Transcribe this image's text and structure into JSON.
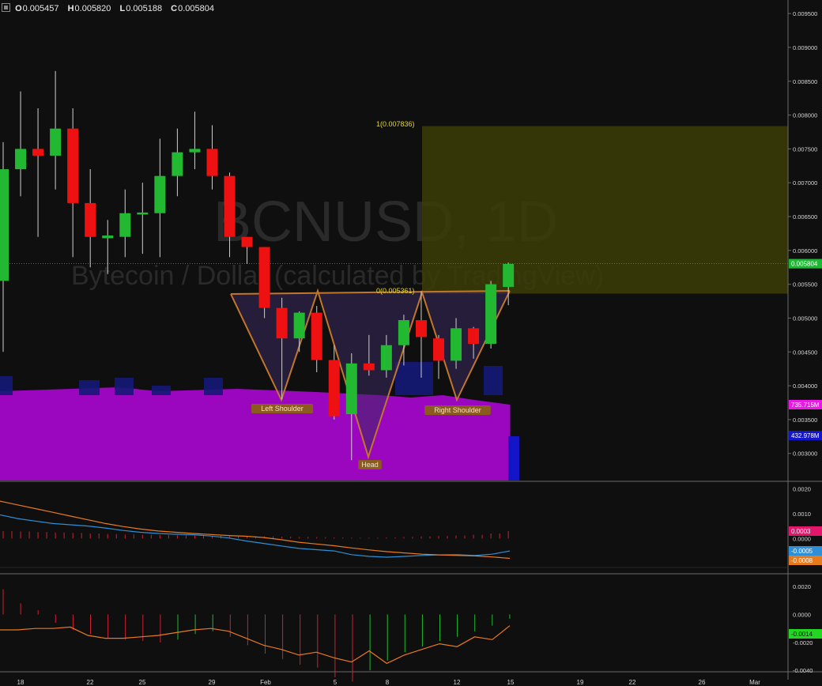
{
  "header": {
    "open_label": "O",
    "open": "0.005457",
    "high_label": "H",
    "high": "0.005820",
    "low_label": "L",
    "low": "0.005188",
    "close_label": "C",
    "close": "0.005804"
  },
  "watermark": {
    "symbol": "BCNUSD, 1D",
    "description": "Bytecoin / Dollar (calculated by TradingView)"
  },
  "colors": {
    "background": "#0f0f0f",
    "up": "#22b832",
    "down": "#ee1111",
    "pattern_line": "#c2762c",
    "pattern_fill": "#3a2a60",
    "target_box": "#3c3d06",
    "volume_fill": "#9b06bf",
    "volume_bar": "#141a78",
    "macd_line": "#2e8fd6",
    "signal_line": "#e87a1e",
    "last_price_tag": "#1db734",
    "vol_ma_tag": "#e71be3",
    "vol_tag": "#1515c8",
    "grid": "#6b6b6b"
  },
  "chart_data": [
    {
      "type": "candlestick",
      "title": "BCNUSD, 1D",
      "x_tick_labels": [
        "18",
        "22",
        "25",
        "29",
        "Feb",
        "5",
        "8",
        "12",
        "15",
        "19",
        "22",
        "26",
        "Mar"
      ],
      "y_ticks": [
        "0.009500",
        "0.009000",
        "0.008500",
        "0.008000",
        "0.007500",
        "0.007000",
        "0.006500",
        "0.006000",
        "0.005500",
        "0.005000",
        "0.004500",
        "0.004000",
        "0.003500",
        "0.003000"
      ],
      "ylim": [
        0.0026,
        0.0097
      ],
      "last_price": "0.005804",
      "candles": [
        {
          "o": 0.00555,
          "h": 0.0076,
          "l": 0.0045,
          "c": 0.0072
        },
        {
          "o": 0.0072,
          "h": 0.00835,
          "l": 0.0068,
          "c": 0.0075
        },
        {
          "o": 0.0075,
          "h": 0.0081,
          "l": 0.0062,
          "c": 0.0074
        },
        {
          "o": 0.0074,
          "h": 0.00865,
          "l": 0.0069,
          "c": 0.0078
        },
        {
          "o": 0.0078,
          "h": 0.0081,
          "l": 0.0059,
          "c": 0.0067
        },
        {
          "o": 0.0067,
          "h": 0.0072,
          "l": 0.00575,
          "c": 0.0062
        },
        {
          "o": 0.00618,
          "h": 0.00645,
          "l": 0.00565,
          "c": 0.00622
        },
        {
          "o": 0.0062,
          "h": 0.0069,
          "l": 0.0059,
          "c": 0.00655
        },
        {
          "o": 0.00653,
          "h": 0.007,
          "l": 0.00595,
          "c": 0.00656
        },
        {
          "o": 0.00655,
          "h": 0.00765,
          "l": 0.0059,
          "c": 0.0071
        },
        {
          "o": 0.0071,
          "h": 0.0078,
          "l": 0.0068,
          "c": 0.00745
        },
        {
          "o": 0.00745,
          "h": 0.00805,
          "l": 0.0072,
          "c": 0.0075
        },
        {
          "o": 0.0075,
          "h": 0.00785,
          "l": 0.0069,
          "c": 0.0071
        },
        {
          "o": 0.0071,
          "h": 0.00715,
          "l": 0.0059,
          "c": 0.0062
        },
        {
          "o": 0.0062,
          "h": 0.0062,
          "l": 0.0058,
          "c": 0.00605
        },
        {
          "o": 0.00605,
          "h": 0.00605,
          "l": 0.005,
          "c": 0.00515
        },
        {
          "o": 0.00515,
          "h": 0.0053,
          "l": 0.0038,
          "c": 0.0047
        },
        {
          "o": 0.0047,
          "h": 0.0051,
          "l": 0.0045,
          "c": 0.00508
        },
        {
          "o": 0.00508,
          "h": 0.00518,
          "l": 0.0042,
          "c": 0.00438
        },
        {
          "o": 0.00438,
          "h": 0.0046,
          "l": 0.0035,
          "c": 0.00355
        },
        {
          "o": 0.00358,
          "h": 0.00448,
          "l": 0.0029,
          "c": 0.00433
        },
        {
          "o": 0.00433,
          "h": 0.00475,
          "l": 0.00415,
          "c": 0.00423
        },
        {
          "o": 0.00423,
          "h": 0.00475,
          "l": 0.00412,
          "c": 0.0046
        },
        {
          "o": 0.0046,
          "h": 0.00505,
          "l": 0.0043,
          "c": 0.00497
        },
        {
          "o": 0.00497,
          "h": 0.0054,
          "l": 0.00412,
          "c": 0.00472
        },
        {
          "o": 0.0047,
          "h": 0.00475,
          "l": 0.0041,
          "c": 0.00437
        },
        {
          "o": 0.00437,
          "h": 0.005,
          "l": 0.00425,
          "c": 0.00485
        },
        {
          "o": 0.00485,
          "h": 0.00487,
          "l": 0.0044,
          "c": 0.00462
        },
        {
          "o": 0.00462,
          "h": 0.00555,
          "l": 0.00455,
          "c": 0.0055
        },
        {
          "o": 0.00546,
          "h": 0.00582,
          "l": 0.00519,
          "c": 0.0058
        }
      ],
      "annotations": {
        "neckline_label": "0(0.005361)",
        "target_label": "1(0.007836)",
        "left_shoulder": "Left Shoulder",
        "head": "Head",
        "right_shoulder": "Right Shoulder",
        "neckline_value": 0.005361,
        "target_value": 0.007836
      }
    },
    {
      "type": "volume",
      "tags": [
        "735.715M",
        "432.978M"
      ],
      "volume_ma_value": 735.715,
      "last_volume": 432.978
    },
    {
      "type": "line",
      "indicator": "MACD",
      "y_ticks": [
        "0.0020",
        "0.0010",
        "0.0000"
      ],
      "ylim": [
        -0.0011,
        0.0022
      ],
      "tags": [
        "0.0003",
        "-0.0005",
        "-0.0008"
      ],
      "macd_line": [
        0.00095,
        0.0008,
        0.0007,
        0.0006,
        0.00055,
        0.0005,
        0.00042,
        0.00032,
        0.00025,
        0.0002,
        0.00017,
        0.00015,
        0.0001,
        2e-05,
        -0.0001,
        -0.0002,
        -0.0003,
        -0.0004,
        -0.00045,
        -0.0005,
        -0.00065,
        -0.00072,
        -0.00075,
        -0.00072,
        -0.00068,
        -0.00066,
        -0.00065,
        -0.00068,
        -0.00063,
        -0.0005
      ],
      "signal_line": [
        0.0015,
        0.00135,
        0.0012,
        0.00105,
        0.0009,
        0.00075,
        0.0006,
        0.00048,
        0.00038,
        0.0003,
        0.00025,
        0.0002,
        0.00016,
        0.00012,
        9e-05,
        4e-05,
        -5e-05,
        -0.00015,
        -0.00022,
        -0.00029,
        -0.00038,
        -0.00046,
        -0.00053,
        -0.00058,
        -0.00063,
        -0.00066,
        -0.00068,
        -0.0007,
        -0.00074,
        -0.0008
      ],
      "histogram": [
        0.0003,
        0.00028,
        0.00026,
        0.00024,
        0.00022,
        0.0002,
        0.00018,
        0.00016,
        0.00015,
        0.00014,
        0.00013,
        0.00012,
        0.00011,
        0.0001,
        9e-05,
        8e-05,
        7e-05,
        6e-05,
        5e-05,
        4e-05,
        3e-05,
        3e-05,
        4e-05,
        6e-05,
        8e-05,
        0.0001,
        0.00012,
        0.00015,
        0.0002,
        0.0003
      ]
    },
    {
      "type": "line",
      "indicator": "oscillator",
      "y_ticks": [
        "0.0020",
        "0.0000",
        "-0.0020",
        "-0.0040"
      ],
      "ylim": [
        -0.0041,
        0.0028
      ],
      "tag": "-0.0014",
      "line": [
        -0.0011,
        -0.0011,
        -0.001,
        -0.001,
        -0.0009,
        -0.0015,
        -0.0017,
        -0.0017,
        -0.0016,
        -0.0015,
        -0.0013,
        -0.0011,
        -0.001,
        -0.0012,
        -0.0017,
        -0.0022,
        -0.0025,
        -0.0029,
        -0.0027,
        -0.0031,
        -0.0034,
        -0.0026,
        -0.0035,
        -0.0029,
        -0.0025,
        -0.0021,
        -0.0023,
        -0.0016,
        -0.0018,
        -0.0008
      ],
      "histogram": [
        0.0018,
        0.0008,
        0.0003,
        -0.0006,
        -0.0011,
        -0.0014,
        -0.0017,
        -0.0018,
        -0.0019,
        -0.002,
        -0.0018,
        -0.0014,
        -0.0012,
        -0.0016,
        -0.0022,
        -0.0028,
        -0.0032,
        -0.0036,
        -0.0038,
        -0.0045,
        -0.0048,
        -0.004,
        -0.0033,
        -0.0027,
        -0.0023,
        -0.0019,
        -0.0016,
        -0.0012,
        -0.0008,
        -0.0003
      ]
    }
  ]
}
